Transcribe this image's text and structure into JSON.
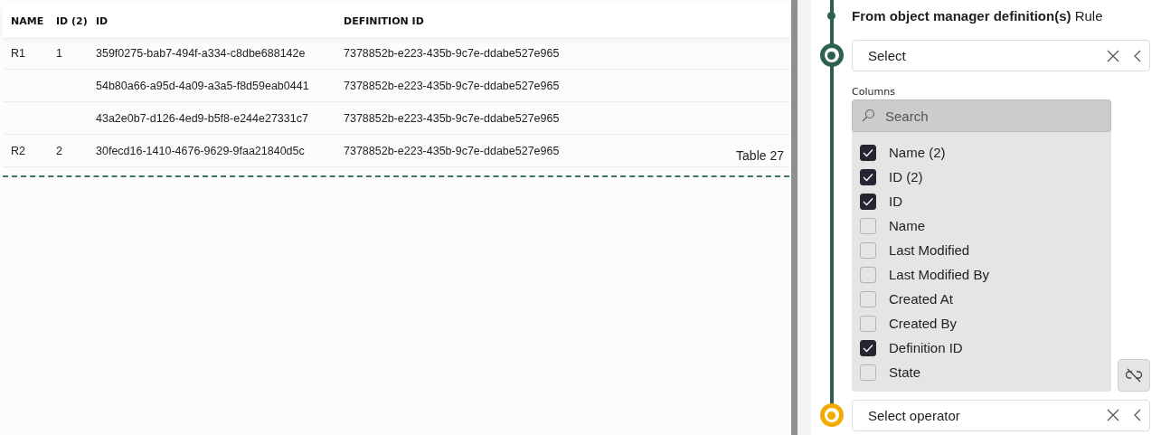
{
  "table": {
    "columns": [
      "NAME",
      "ID (2)",
      "ID",
      "DEFINITION ID"
    ],
    "rows": [
      {
        "cells": [
          "R1",
          "1",
          "359f0275-bab7-494f-a334-c8dbe688142e",
          "7378852b-e223-435b-9c7e-ddabe527e965"
        ]
      },
      {
        "cells": [
          "",
          "",
          "54b80a66-a95d-4a09-a3a5-f8d59eab0441",
          "7378852b-e223-435b-9c7e-ddabe527e965"
        ]
      },
      {
        "cells": [
          "",
          "",
          "43a2e0b7-d126-4ed9-b5f8-e244e27331c7",
          "7378852b-e223-435b-9c7e-ddabe527e965"
        ]
      },
      {
        "cells": [
          "R2",
          "2",
          "30fecd16-1410-4676-9629-9faa21840d5c",
          "7378852b-e223-435b-9c7e-ddabe527e965"
        ],
        "note": "Table 27"
      }
    ]
  },
  "rule": {
    "title": "**From object manager definition(s)** Rule",
    "source": {
      "placeholder": "Select",
      "current": true
    },
    "columns_label": "Columns",
    "search": {
      "placeholder": "Search"
    },
    "columns": [
      {
        "label": "Name (2)",
        "checked": true
      },
      {
        "label": "ID (2)",
        "checked": true
      },
      {
        "label": "ID",
        "checked": true
      },
      {
        "label": "Name",
        "checked": false
      },
      {
        "label": "Last Modified",
        "checked": false
      },
      {
        "label": "Last Modified By",
        "checked": false
      },
      {
        "label": "Created At",
        "checked": false
      },
      {
        "label": "Created By",
        "checked": false
      },
      {
        "label": "Definition ID",
        "checked": true
      },
      {
        "label": "State",
        "checked": false
      }
    ],
    "operator": {
      "placeholder": "Select operator",
      "current": false
    }
  }
}
